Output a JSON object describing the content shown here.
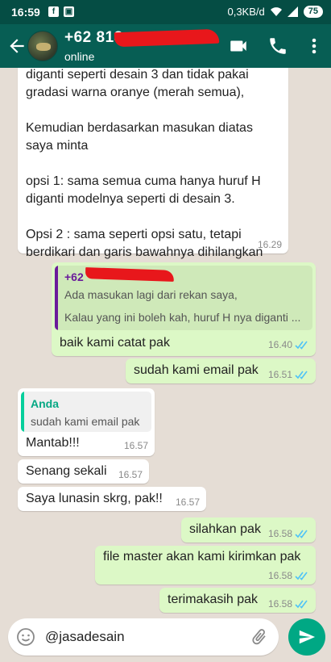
{
  "status_bar": {
    "time": "16:59",
    "network": "0,3KB/d",
    "battery": "75"
  },
  "header": {
    "contact_name": "+62 813",
    "status": "online"
  },
  "messages": [
    {
      "direction": "in",
      "text": "diganti seperti desain 3 dan tidak pakai\ngradasi warna oranye (merah semua),\n\nKemudian berdasarkan masukan diatas\nsaya minta\n\nopsi 1: sama semua cuma hanya huruf H\ndiganti modelnya seperti di desain 3.\n\nOpsi 2 : sama seperti opsi satu, tetapi\nberdikari dan garis bawahnya dihilangkan",
      "time": "16.29"
    },
    {
      "direction": "out",
      "quote_author": "+62",
      "quote_line1": "Ada masukan lagi dari rekan saya,",
      "quote_line2": "Kalau yang ini boleh kah, huruf H nya diganti ...",
      "text": "baik kami catat pak",
      "time": "16.40"
    },
    {
      "direction": "out",
      "text": "sudah kami email pak",
      "time": "16.51"
    },
    {
      "direction": "in",
      "quote_author": "Anda",
      "quote_line1": "sudah kami email pak",
      "text": "Mantab!!!",
      "time": "16.57"
    },
    {
      "direction": "in",
      "text": "Senang sekali",
      "time": "16.57"
    },
    {
      "direction": "in",
      "text": "Saya lunasin skrg, pak!!",
      "time": "16.57"
    },
    {
      "direction": "out",
      "text": "silahkan pak",
      "time": "16.58"
    },
    {
      "direction": "out",
      "text": "file master akan kami kirimkan pak",
      "time": "16.58"
    },
    {
      "direction": "out",
      "text": "terimakasih pak",
      "time": "16.58"
    }
  ],
  "input": {
    "value": "@jasadesain"
  },
  "colors": {
    "header": "#075e54",
    "status_bar": "#054d44",
    "outgoing_bubble": "#dcf8c6",
    "incoming_bubble": "#ffffff",
    "chat_background": "#e5ddd5",
    "read_ticks": "#4fc3f7",
    "send_button": "#00a884",
    "quote_bar_out": "#6a1b9a",
    "quote_bar_in": "#06cf9c",
    "redaction": "#e8171b"
  },
  "icons": {
    "back": "back-arrow-icon",
    "video": "video-call-icon",
    "phone": "phone-icon",
    "menu": "more-vert-icon",
    "emoji": "emoji-icon",
    "attach": "paperclip-icon",
    "send": "send-icon",
    "ticks": "double-check-icon"
  }
}
